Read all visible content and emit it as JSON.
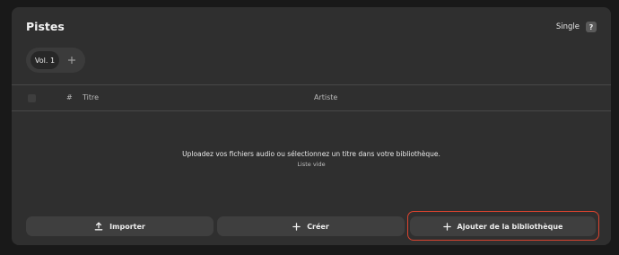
{
  "header": {
    "title": "Pistes",
    "single_label": "Single",
    "help_label": "?"
  },
  "volumes": {
    "active_label": "Vol. 1",
    "add_icon": "plus-icon"
  },
  "table": {
    "columns": {
      "number": "#",
      "title": "Titre",
      "artist": "Artiste"
    }
  },
  "empty_state": {
    "message": "Uploadez vos fichiers audio ou sélectionnez un titre dans votre bibliothèque.",
    "sub": "Liste vide"
  },
  "actions": {
    "import_label": "Importer",
    "import_icon": "upload-icon",
    "create_label": "Créer",
    "create_icon": "plus-icon",
    "library_label": "Ajouter de la bibliothèque",
    "library_icon": "plus-icon"
  },
  "colors": {
    "page_bg": "#191919",
    "panel_bg": "#2f2f2f",
    "button_bg": "#3f3f3f",
    "highlight": "#d9432f"
  }
}
